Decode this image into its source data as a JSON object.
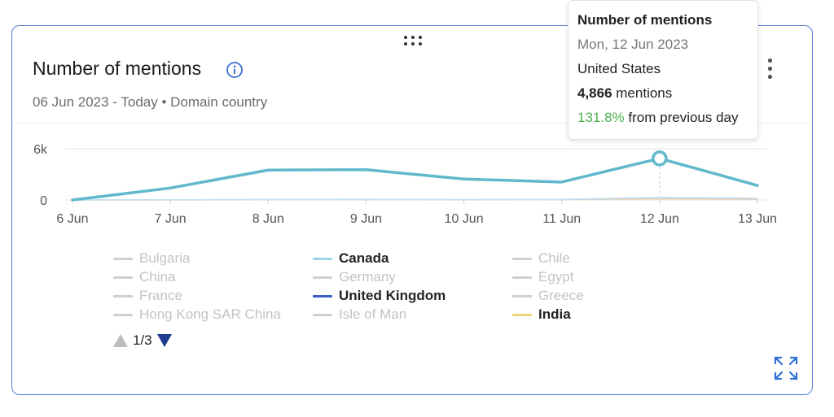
{
  "widget": {
    "title": "Number of mentions",
    "subtitle": "06 Jun 2023 - Today • Domain country"
  },
  "icons": {
    "drag": "drag-handle-icon",
    "info": "info-icon",
    "menu": "kebab-menu-icon",
    "expand": "expand-icon"
  },
  "tooltip": {
    "title": "Number of mentions",
    "date": "Mon, 12 Jun 2023",
    "country": "United States",
    "count": "4,866",
    "count_suffix": " mentions",
    "change_pct": "131.8%",
    "change_suffix": " from previous day"
  },
  "legend": {
    "items": [
      {
        "label": "Bulgaria",
        "active": false,
        "color": "#cfcfcf"
      },
      {
        "label": "Canada",
        "active": true,
        "color": "#9fd4e4"
      },
      {
        "label": "Chile",
        "active": false,
        "color": "#cfcfcf"
      },
      {
        "label": "China",
        "active": false,
        "color": "#cfcfcf"
      },
      {
        "label": "Germany",
        "active": false,
        "color": "#cfcfcf"
      },
      {
        "label": "Egypt",
        "active": false,
        "color": "#cfcfcf"
      },
      {
        "label": "France",
        "active": false,
        "color": "#cfcfcf"
      },
      {
        "label": "United Kingdom",
        "active": true,
        "color": "#3a5fc8"
      },
      {
        "label": "Greece",
        "active": false,
        "color": "#cfcfcf"
      },
      {
        "label": "Hong Kong SAR China",
        "active": false,
        "color": "#cfcfcf"
      },
      {
        "label": "Isle of Man",
        "active": false,
        "color": "#cfcfcf"
      },
      {
        "label": "India",
        "active": true,
        "color": "#f0d27a"
      }
    ],
    "page": "1/3"
  },
  "chart_data": {
    "type": "line",
    "x": [
      "6 Jun",
      "7 Jun",
      "8 Jun",
      "9 Jun",
      "10 Jun",
      "11 Jun",
      "12 Jun",
      "13 Jun"
    ],
    "ylim": [
      0,
      6000
    ],
    "yticks": [
      {
        "value": 0,
        "label": "0"
      },
      {
        "value": 6000,
        "label": "6k"
      }
    ],
    "grid": true,
    "highlight": {
      "series": "United States",
      "x": "12 Jun",
      "value": 4866
    },
    "series": [
      {
        "name": "United States",
        "color": "#5fb8cc",
        "width": 3.5,
        "values": [
          0,
          1400,
          3500,
          3550,
          2450,
          2100,
          4866,
          1700
        ]
      },
      {
        "name": "Canada",
        "color": "#bfe3ee",
        "width": 1.5,
        "values": [
          0,
          20,
          60,
          80,
          50,
          70,
          300,
          200
        ]
      },
      {
        "name": "United Kingdom",
        "color": "#d6c7e6",
        "width": 1.5,
        "values": [
          0,
          10,
          40,
          50,
          30,
          40,
          200,
          120
        ]
      },
      {
        "name": "India",
        "color": "#f3dfa6",
        "width": 1.5,
        "values": [
          0,
          5,
          20,
          30,
          15,
          25,
          90,
          60
        ]
      }
    ]
  }
}
